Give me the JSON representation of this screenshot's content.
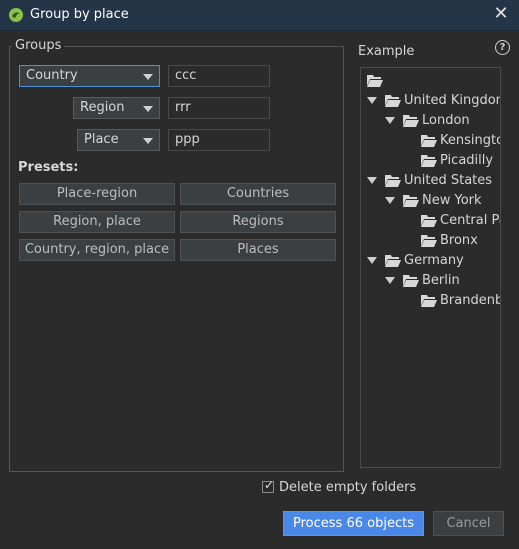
{
  "window": {
    "title": "Group by place"
  },
  "groups": {
    "label": "Groups",
    "rows": [
      {
        "level": "Country",
        "value": "ccc"
      },
      {
        "level": "Region",
        "value": "rrr"
      },
      {
        "level": "Place",
        "value": "ppp"
      }
    ]
  },
  "presets": {
    "label": "Presets:",
    "buttons": [
      "Place-region",
      "Countries",
      "Region, place",
      "Regions",
      "Country, region, place",
      "Places"
    ]
  },
  "example": {
    "label": "Example",
    "tree": [
      {
        "text": "",
        "depth": 0,
        "expanded": false,
        "arrow": false
      },
      {
        "text": "United Kingdom",
        "depth": 0,
        "arrow": true
      },
      {
        "text": "London",
        "depth": 1,
        "arrow": true
      },
      {
        "text": "Kensington",
        "depth": 2,
        "arrow": false
      },
      {
        "text": "Picadilly",
        "depth": 2,
        "arrow": false
      },
      {
        "text": "United States",
        "depth": 0,
        "arrow": true
      },
      {
        "text": "New York",
        "depth": 1,
        "arrow": true
      },
      {
        "text": "Central Park",
        "depth": 2,
        "arrow": false
      },
      {
        "text": "Bronx",
        "depth": 2,
        "arrow": false
      },
      {
        "text": "Germany",
        "depth": 0,
        "arrow": true
      },
      {
        "text": "Berlin",
        "depth": 1,
        "arrow": true
      },
      {
        "text": "Brandenburg",
        "depth": 2,
        "arrow": false
      }
    ]
  },
  "options": {
    "delete_empty_folders": "Delete empty folders",
    "delete_empty_checked": true
  },
  "actions": {
    "process": "Process 66 objects",
    "cancel": "Cancel"
  },
  "colors": {
    "accent": "#4a88e8",
    "titlebar": "#253548",
    "background": "#2b2b2b"
  }
}
